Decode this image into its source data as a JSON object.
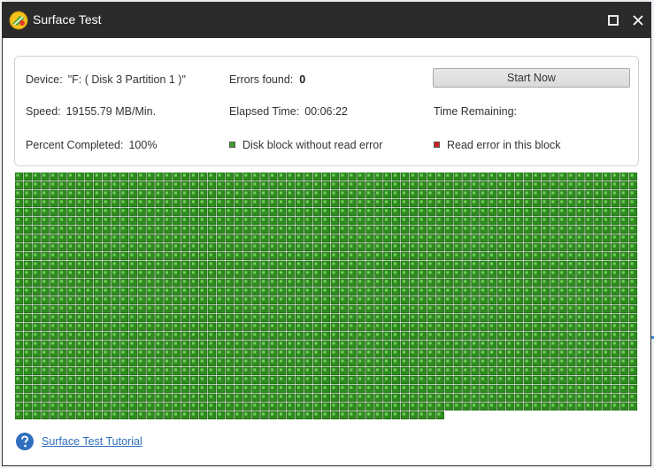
{
  "window": {
    "title": "Surface Test"
  },
  "info": {
    "device_label": "Device:",
    "device_value": "\"F: ( Disk 3 Partition 1 )\"",
    "errors_label": "Errors found:",
    "errors_value": "0",
    "speed_label": "Speed:",
    "speed_value": "19155.79 MB/Min.",
    "elapsed_label": "Elapsed Time:",
    "elapsed_value": "00:06:22",
    "remaining_label": "Time Remaining:",
    "remaining_value": "",
    "percent_label": "Percent Completed:",
    "percent_value": "100%"
  },
  "actions": {
    "start_label": "Start Now"
  },
  "legend": {
    "ok_label": "Disk block without read error",
    "ok_color": "#3aa02a",
    "error_label": "Read error in this block",
    "error_color": "#d42020"
  },
  "block_grid": {
    "columns": 71,
    "full_rows": 27,
    "last_row_blocks": 49,
    "error_blocks": 0,
    "block_color": "#2e8b1f"
  },
  "footer": {
    "tutorial_link": "Surface Test Tutorial"
  }
}
